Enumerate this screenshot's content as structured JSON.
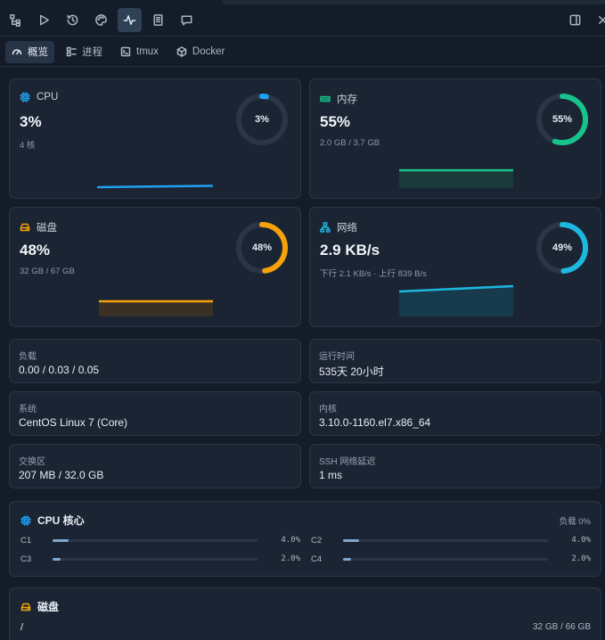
{
  "toolbar": {
    "icons": [
      "file-tree-icon",
      "run-icon",
      "history-icon",
      "palette-icon",
      "activity-icon",
      "notebook-icon",
      "comment-icon"
    ],
    "active": "activity-icon",
    "right_icons": [
      "split-panel-icon",
      "close-icon"
    ]
  },
  "tabs": [
    {
      "label": "概览",
      "icon": "gauge-icon",
      "active": true
    },
    {
      "label": "进程",
      "icon": "process-list-icon",
      "active": false
    },
    {
      "label": "tmux",
      "icon": "terminal-icon",
      "active": false
    },
    {
      "label": "Docker",
      "icon": "docker-box-icon",
      "active": false
    }
  ],
  "cpu": {
    "label": "CPU",
    "value": "3%",
    "sub": "4 核",
    "ring_pct": "3%",
    "percent": 3,
    "color": "#1ea1f2"
  },
  "memory": {
    "label": "内存",
    "value": "55%",
    "sub": "2.0 GB / 3.7 GB",
    "ring_pct": "55%",
    "percent": 55,
    "color": "#17c38b"
  },
  "disk": {
    "label": "磁盘",
    "value": "48%",
    "sub": "32 GB / 67 GB",
    "ring_pct": "48%",
    "percent": 48,
    "color": "#f5a10a"
  },
  "network": {
    "label": "网络",
    "value": "2.9 KB/s",
    "sub": "下行 2.1 KB/s · 上行 839 B/s",
    "ring_pct": "49%",
    "percent": 49,
    "color": "#1db8df"
  },
  "info": {
    "load": {
      "key": "负载",
      "value": "0.00 / 0.03 / 0.05"
    },
    "uptime": {
      "key": "运行时间",
      "value": "535天 20小时"
    },
    "os": {
      "key": "系统",
      "value": "CentOS Linux 7 (Core)"
    },
    "kernel": {
      "key": "内核",
      "value": "3.10.0-1160.el7.x86_64"
    },
    "swap": {
      "key": "交换区",
      "value": "207 MB / 32.0 GB"
    },
    "ssh": {
      "key": "SSH 网络延迟",
      "value": "1 ms"
    }
  },
  "cpu_cores": {
    "title": "CPU 核心",
    "load_label": "负载 0%",
    "cores": [
      {
        "name": "C1",
        "value": "4.0%",
        "percent": 4
      },
      {
        "name": "C2",
        "value": "4.0%",
        "percent": 4
      },
      {
        "name": "C3",
        "value": "2.0%",
        "percent": 2
      },
      {
        "name": "C4",
        "value": "2.0%",
        "percent": 2
      }
    ]
  },
  "disks": {
    "title": "磁盘",
    "mounts": [
      {
        "path": "/",
        "usage": "32 GB / 66 GB"
      }
    ]
  }
}
